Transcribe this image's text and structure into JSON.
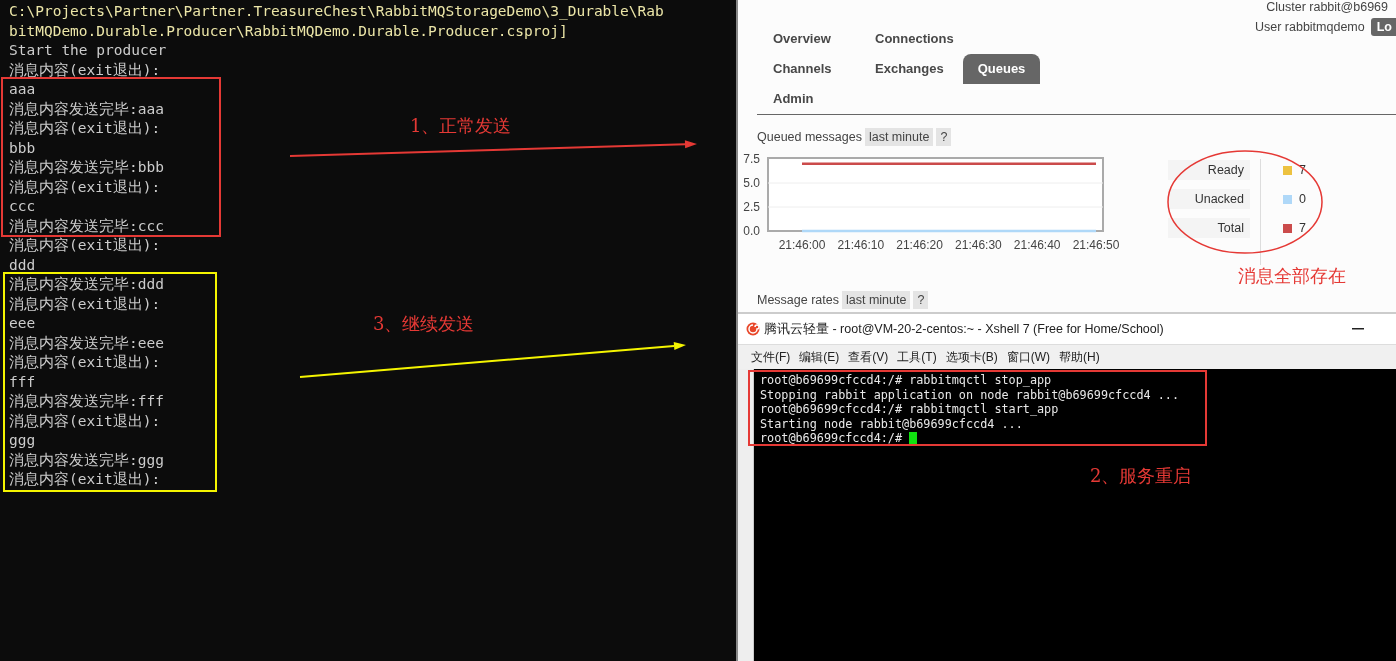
{
  "console": {
    "lines": [
      {
        "kind": "path",
        "text": "C:\\Projects\\Partner\\Partner.TreasureChest\\RabbitMQStorageDemo\\3_Durable\\Rab"
      },
      {
        "kind": "path",
        "text": "bitMQDemo.Durable.Producer\\RabbitMQDemo.Durable.Producer.csproj]"
      },
      {
        "kind": "out",
        "text": "Start the producer"
      },
      {
        "kind": "out",
        "text": "消息内容(exit退出):"
      },
      {
        "kind": "out",
        "text": "aaa"
      },
      {
        "kind": "out",
        "text": "消息内容发送完毕:aaa"
      },
      {
        "kind": "out",
        "text": "消息内容(exit退出):"
      },
      {
        "kind": "out",
        "text": "bbb"
      },
      {
        "kind": "out",
        "text": "消息内容发送完毕:bbb"
      },
      {
        "kind": "out",
        "text": "消息内容(exit退出):"
      },
      {
        "kind": "out",
        "text": "ccc"
      },
      {
        "kind": "out",
        "text": "消息内容发送完毕:ccc"
      },
      {
        "kind": "out",
        "text": "消息内容(exit退出):"
      },
      {
        "kind": "out",
        "text": "ddd"
      },
      {
        "kind": "out",
        "text": "消息内容发送完毕:ddd"
      },
      {
        "kind": "out",
        "text": "消息内容(exit退出):"
      },
      {
        "kind": "out",
        "text": "eee"
      },
      {
        "kind": "out",
        "text": "消息内容发送完毕:eee"
      },
      {
        "kind": "out",
        "text": "消息内容(exit退出):"
      },
      {
        "kind": "out",
        "text": "fff"
      },
      {
        "kind": "out",
        "text": "消息内容发送完毕:fff"
      },
      {
        "kind": "out",
        "text": "消息内容(exit退出):"
      },
      {
        "kind": "out",
        "text": "ggg"
      },
      {
        "kind": "out",
        "text": "消息内容发送完毕:ggg"
      },
      {
        "kind": "out",
        "text": "消息内容(exit退出):"
      }
    ]
  },
  "browser": {
    "cluster": "Cluster rabbit@b6969",
    "user": "User rabbitmqdemo",
    "logout": "Lo",
    "tabs": [
      {
        "label": "Overview",
        "selected": false
      },
      {
        "label": "Connections",
        "selected": false
      },
      {
        "label": "Channels",
        "selected": false
      },
      {
        "label": "Exchanges",
        "selected": false
      },
      {
        "label": "Queues",
        "selected": true
      },
      {
        "label": "Admin",
        "selected": false
      }
    ],
    "queued_messages": {
      "label": "Queued messages",
      "range": "last minute",
      "help": "?",
      "chart_data": {
        "type": "line",
        "categories": [
          "21:46:00",
          "21:46:10",
          "21:46:20",
          "21:46:30",
          "21:46:40",
          "21:46:50"
        ],
        "ylim": [
          0,
          7.5
        ],
        "yticks": [
          {
            "value": 0,
            "label": "0.0"
          },
          {
            "value": 2.5,
            "label": "2.5"
          },
          {
            "value": 5,
            "label": "5.0"
          },
          {
            "value": 7.5,
            "label": "7.5"
          }
        ],
        "series": [
          {
            "name": "Ready",
            "color": "#edc240",
            "values": [
              null,
              null,
              null,
              null,
              null,
              null
            ]
          },
          {
            "name": "Unacked",
            "color": "#afd8f8",
            "values": [
              0,
              0,
              0,
              0,
              0,
              0
            ]
          },
          {
            "name": "Total",
            "color": "#cb4b4b",
            "values": [
              7,
              7,
              7,
              7,
              7,
              7
            ]
          }
        ]
      },
      "legend": [
        {
          "value": "7"
        },
        {
          "value": "0"
        },
        {
          "value": "7"
        }
      ]
    },
    "message_rates": {
      "label": "Message rates",
      "range": "last minute",
      "help": "?"
    }
  },
  "xshell": {
    "title": "腾讯云轻量 - root@VM-20-2-centos:~ - Xshell 7 (Free for Home/School)",
    "menu": [
      "文件(F)",
      "编辑(E)",
      "查看(V)",
      "工具(T)",
      "选项卡(B)",
      "窗口(W)",
      "帮助(H)"
    ],
    "terminal": [
      "root@b69699cfccd4:/# rabbitmqctl stop_app",
      "Stopping rabbit application on node rabbit@b69699cfccd4 ...",
      "root@b69699cfccd4:/# rabbitmqctl start_app",
      "Starting node rabbit@b69699cfccd4 ...",
      "root@b69699cfccd4:/# "
    ]
  },
  "annotations": [
    {
      "kind": "box",
      "color": "#e53935"
    },
    {
      "kind": "arrow",
      "color": "#e53935"
    },
    {
      "kind": "label",
      "color": "#e53935",
      "text": "1、正常发送"
    },
    {
      "kind": "box",
      "color": "#f5f500"
    },
    {
      "kind": "arrow",
      "color": "#f5f500"
    },
    {
      "kind": "label",
      "color": "#e53935",
      "text": "3、继续发送"
    },
    {
      "kind": "ellipse",
      "color": "#e53935"
    },
    {
      "kind": "label",
      "color": "#e53935",
      "text": "消息全部存在"
    },
    {
      "kind": "box",
      "color": "#e53935"
    },
    {
      "kind": "label",
      "color": "#e53935",
      "text": "2、服务重启"
    }
  ]
}
